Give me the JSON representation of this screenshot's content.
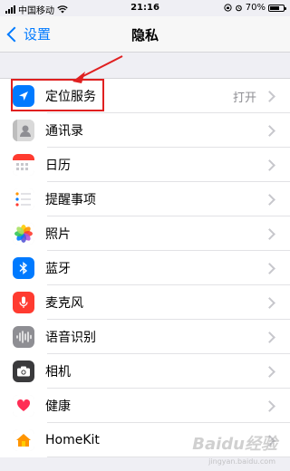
{
  "status_bar": {
    "carrier": "中国移动",
    "time": "21:16",
    "battery_percent": "70%",
    "battery_level": 0.7
  },
  "nav": {
    "back_label": "设置",
    "title": "隐私"
  },
  "rows": [
    {
      "label": "定位服务",
      "value": "打开",
      "icon": "location-arrow-icon",
      "color": "#007aff"
    },
    {
      "label": "通讯录",
      "value": "",
      "icon": "contacts-icon",
      "color": "#d9d9d9"
    },
    {
      "label": "日历",
      "value": "",
      "icon": "calendar-icon",
      "color": "#ffffff"
    },
    {
      "label": "提醒事项",
      "value": "",
      "icon": "reminders-icon",
      "color": "#ffffff"
    },
    {
      "label": "照片",
      "value": "",
      "icon": "photos-icon",
      "color": "#ffffff"
    },
    {
      "label": "蓝牙",
      "value": "",
      "icon": "bluetooth-icon",
      "color": "#007aff"
    },
    {
      "label": "麦克风",
      "value": "",
      "icon": "microphone-icon",
      "color": "#ff3b30"
    },
    {
      "label": "语音识别",
      "value": "",
      "icon": "speech-recognition-icon",
      "color": "#8e8e93"
    },
    {
      "label": "相机",
      "value": "",
      "icon": "camera-icon",
      "color": "#3a3a3c"
    },
    {
      "label": "健康",
      "value": "",
      "icon": "health-icon",
      "color": "#ffffff"
    },
    {
      "label": "HomeKit",
      "value": "",
      "icon": "homekit-icon",
      "color": "#ffffff"
    }
  ],
  "watermark": {
    "text": "Baidu经验",
    "sub": "jingyan.baidu.com"
  }
}
